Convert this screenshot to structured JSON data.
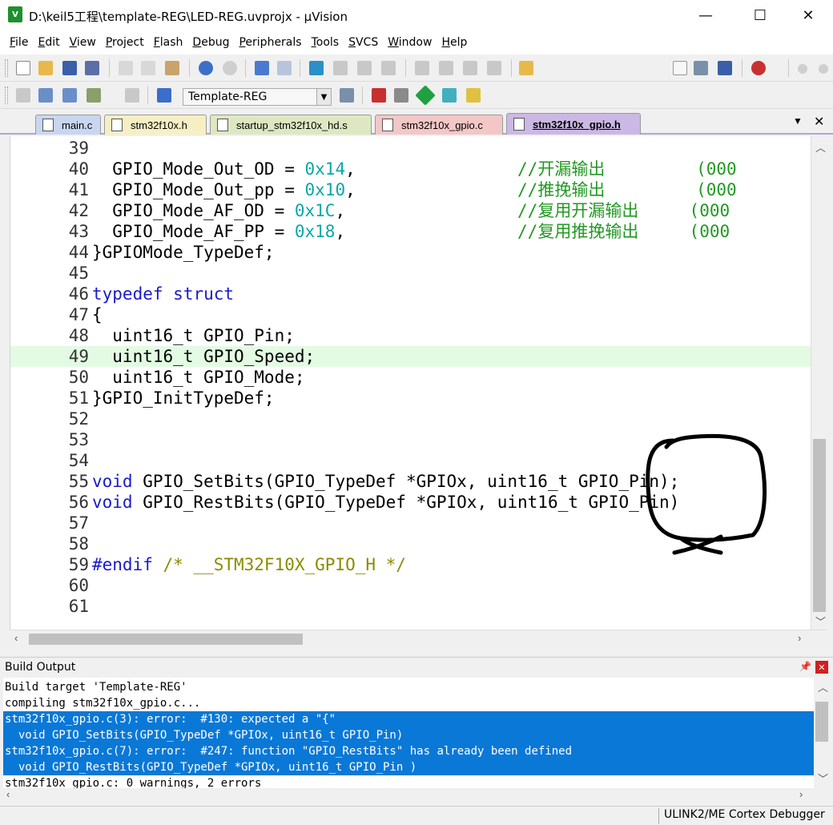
{
  "window": {
    "title": "D:\\keil5工程\\template-REG\\LED-REG.uvprojx - µVision",
    "app_icon_text": "V",
    "minimize": "—",
    "maximize": "☐",
    "close": "✕"
  },
  "menu": [
    "File",
    "Edit",
    "View",
    "Project",
    "Flash",
    "Debug",
    "Peripherals",
    "Tools",
    "SVCS",
    "Window",
    "Help"
  ],
  "toolbar2": {
    "target": "Template-REG"
  },
  "tabs": [
    {
      "label": "main.c",
      "color": "#c8d6f0"
    },
    {
      "label": "stm32f10x.h",
      "color": "#f7efc4"
    },
    {
      "label": "startup_stm32f10x_hd.s",
      "color": "#dde8c2"
    },
    {
      "label": "stm32f10x_gpio.c",
      "color": "#f4c7c7"
    },
    {
      "label": "stm32f10x_gpio.h",
      "color": "#cbb8e4",
      "active": true
    }
  ],
  "tab_menu": "▼",
  "tab_close": "✕",
  "editor": {
    "lines": [
      {
        "n": "39",
        "t": ""
      },
      {
        "n": "40",
        "t": "  GPIO_Mode_Out_OD = 0x14,                //开漏输出         (000"
      },
      {
        "n": "41",
        "t": "  GPIO_Mode_Out_pp = 0x10,                //推挽输出         (000"
      },
      {
        "n": "42",
        "t": "  GPIO_Mode_AF_OD = 0x1C,                 //复用开漏输出     (000"
      },
      {
        "n": "43",
        "t": "  GPIO_Mode_AF_PP = 0x18,                 //复用推挽输出     (000"
      },
      {
        "n": "44",
        "t": "}GPIOMode_TypeDef;"
      },
      {
        "n": "45",
        "t": ""
      },
      {
        "n": "46",
        "t": "typedef struct"
      },
      {
        "n": "47",
        "t": "{"
      },
      {
        "n": "48",
        "t": "  uint16_t GPIO_Pin;"
      },
      {
        "n": "49",
        "t": "  uint16_t GPIO_Speed;"
      },
      {
        "n": "50",
        "t": "  uint16_t GPIO_Mode;"
      },
      {
        "n": "51",
        "t": "}GPIO_InitTypeDef;"
      },
      {
        "n": "52",
        "t": ""
      },
      {
        "n": "53",
        "t": ""
      },
      {
        "n": "54",
        "t": ""
      },
      {
        "n": "55",
        "t": "void GPIO_SetBits(GPIO_TypeDef *GPIOx, uint16_t GPIO_Pin);"
      },
      {
        "n": "56",
        "t": "void GPIO_RestBits(GPIO_TypeDef *GPIOx, uint16_t GPIO_Pin)"
      },
      {
        "n": "57",
        "t": ""
      },
      {
        "n": "58",
        "t": ""
      },
      {
        "n": "59",
        "t": "#endif /* __STM32F10X_GPIO_H */"
      },
      {
        "n": "60",
        "t": ""
      },
      {
        "n": "61",
        "t": ""
      }
    ]
  },
  "output": {
    "title": "Build Output",
    "pin": "📌",
    "close": "✕",
    "lines": [
      {
        "t": "Build target 'Template-REG'",
        "sel": false
      },
      {
        "t": "compiling stm32f10x_gpio.c...",
        "sel": false
      },
      {
        "t": "stm32f10x_gpio.c(3): error:  #130: expected a \"{\"",
        "sel": true
      },
      {
        "t": "  void GPIO_SetBits(GPIO_TypeDef *GPIOx, uint16_t GPIO_Pin)",
        "sel": true
      },
      {
        "t": "stm32f10x_gpio.c(7): error:  #247: function \"GPIO_RestBits\" has already been defined",
        "sel": true
      },
      {
        "t": "  void GPIO_RestBits(GPIO_TypeDef *GPIOx, uint16_t GPIO_Pin )",
        "sel": true
      },
      {
        "t": "stm32f10x_gpio.c: 0 warnings, 2 errors",
        "sel": false
      }
    ]
  },
  "status": {
    "debugger": "ULINK2/ME Cortex Debugger"
  },
  "colors": {
    "selection": "#0a78d7",
    "current_line": "#e3fbe3",
    "active_tab": "#cbb8e4",
    "keyword": "#1a1acd",
    "number": "#0aa7a7",
    "comment": "#229922",
    "annotation": "#000000"
  }
}
